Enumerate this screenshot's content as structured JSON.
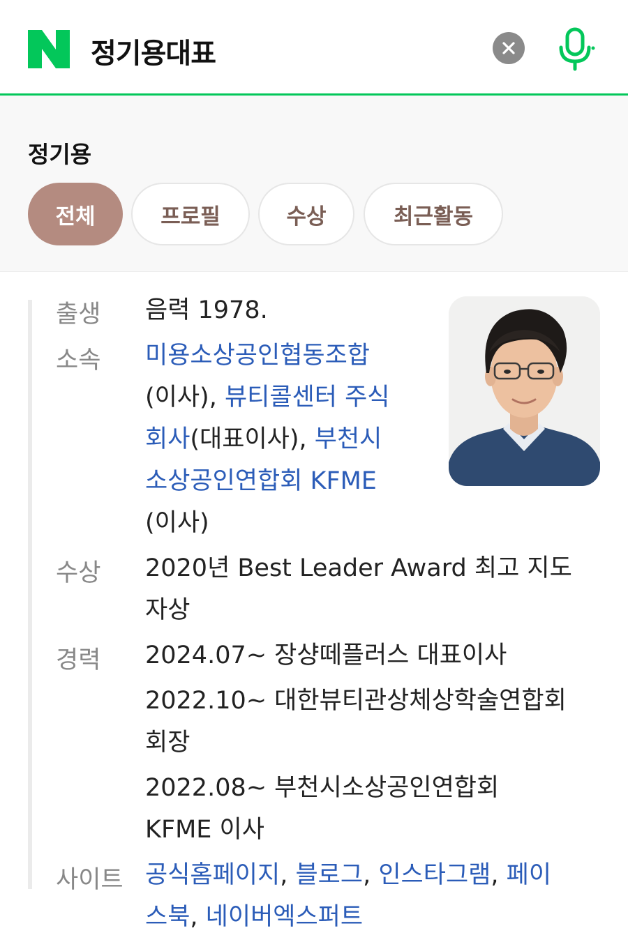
{
  "search": {
    "query": "정기용대표"
  },
  "profile": {
    "name": "정기용",
    "tabs": [
      {
        "label": "전체",
        "active": true
      },
      {
        "label": "프로필",
        "active": false
      },
      {
        "label": "수상",
        "active": false
      },
      {
        "label": "최근활동",
        "active": false
      }
    ]
  },
  "info": {
    "birth": {
      "label": "출생",
      "value": "음력 1978."
    },
    "affiliation": {
      "label": "소속",
      "org1": "미용소상공인협동조합",
      "role1": "(이사), ",
      "org2_line1": "뷰티콜센터 주식",
      "org2_line2": "회사",
      "role2": "(대표이사), ",
      "org3_line1": "부천시",
      "org3_line2": "소상공인연합회 KFME",
      "role3": "(이사)"
    },
    "award": {
      "label": "수상",
      "line1": "2020년 Best Leader Award 최고 지도",
      "line2": "자상"
    },
    "career": {
      "label": "경력",
      "item1": "2024.07~ 장샹떼플러스 대표이사",
      "item2_line1": "2022.10~ 대한뷰티관상체상학술연합회",
      "item2_line2": "회장",
      "item3_line1": "2022.08~ 부천시소상공인연합회",
      "item3_line2": "KFME 이사"
    },
    "sites": {
      "label": "사이트",
      "link1": "공식홈페이지",
      "link2": "블로그",
      "link3": "인스타그램",
      "link4_line1": "페이",
      "link4_line2": "스북",
      "link5": "네이버엑스퍼트",
      "separator": ", "
    }
  },
  "colors": {
    "naver_green": "#03c75a",
    "tab_active": "#b48b80",
    "link": "#2b5cb8"
  }
}
